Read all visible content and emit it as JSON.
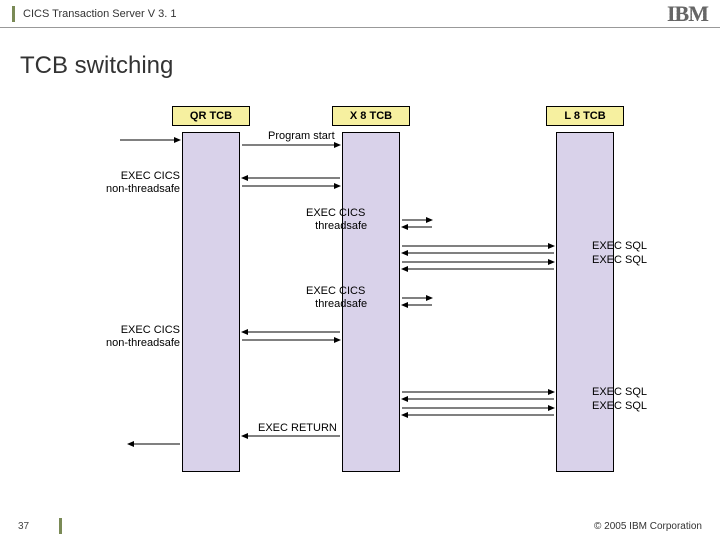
{
  "header": {
    "title": "CICS Transaction Server V 3. 1",
    "logo": "IBM"
  },
  "title": "TCB switching",
  "tcb": {
    "qr": "QR TCB",
    "x8": "X 8 TCB",
    "l8": "L 8 TCB"
  },
  "labels": {
    "program_start": "Program start",
    "exec_cics_nonts_1": "EXEC CICS",
    "exec_cics_nonts_1b": "non-threadsafe",
    "exec_cics_ts_1": "EXEC CICS",
    "exec_cics_ts_1b": "threadsafe",
    "exec_sql_1": "EXEC SQL",
    "exec_sql_2": "EXEC SQL",
    "exec_cics_ts_2": "EXEC CICS",
    "exec_cics_ts_2b": "threadsafe",
    "exec_cics_nonts_2": "EXEC CICS",
    "exec_cics_nonts_2b": "non-threadsafe",
    "exec_sql_3": "EXEC SQL",
    "exec_sql_4": "EXEC SQL",
    "exec_return": "EXEC RETURN"
  },
  "footer": {
    "page": "37",
    "copyright": "© 2005 IBM Corporation"
  }
}
